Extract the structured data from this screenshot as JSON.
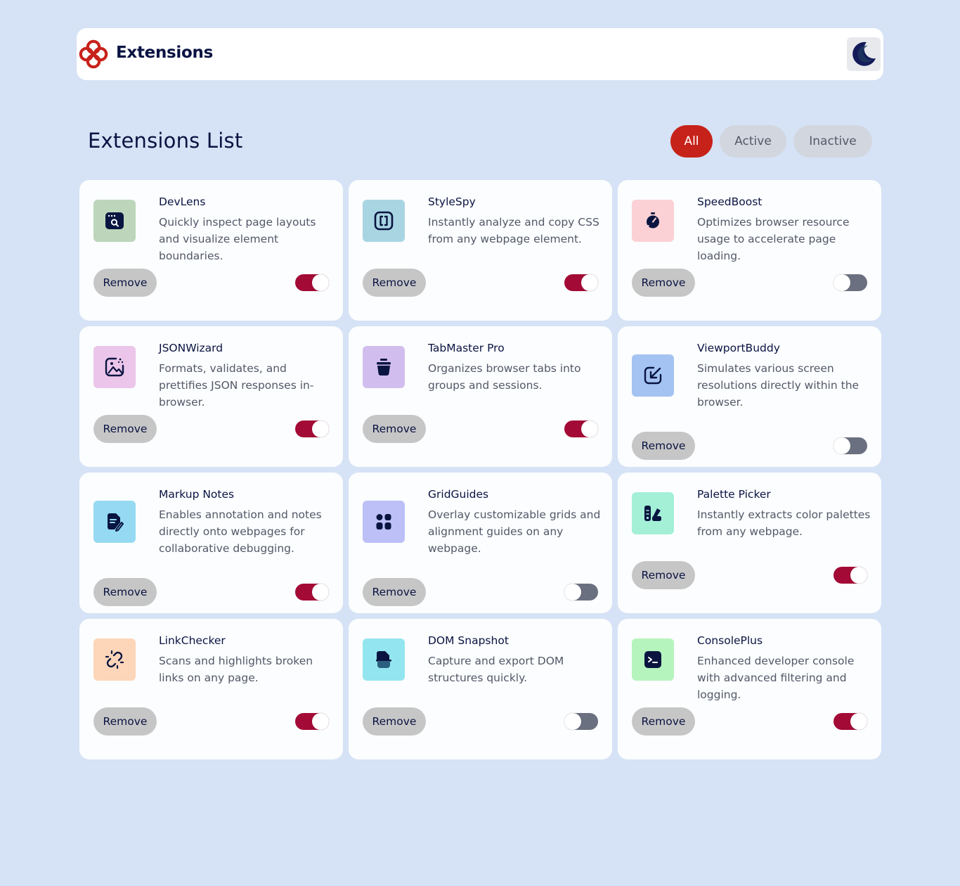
{
  "app": {
    "brand": "Extensions",
    "logo_icon": "logo-icon",
    "theme_icon": "moon-icon"
  },
  "main": {
    "title": "Extensions List",
    "filters": [
      "All",
      "Active",
      "Inactive"
    ],
    "selected_filter": "All"
  },
  "colors": {
    "accent": "#c7221a",
    "toggle_on": "#a30a35",
    "toggle_off": "#6b7080",
    "background": "#d6e2f5"
  },
  "extensions": [
    {
      "name": "DevLens",
      "description": "Quickly inspect page layouts and visualize element boundaries.",
      "active": true,
      "icon": "browser-search-icon",
      "icon_bg": "#bdd6bb",
      "remove_label": "Remove"
    },
    {
      "name": "StyleSpy",
      "description": "Instantly analyze and copy CSS from any webpage element.",
      "active": true,
      "icon": "bracket-box-icon",
      "icon_bg": "#a9d5e3",
      "remove_label": "Remove"
    },
    {
      "name": "SpeedBoost",
      "description": "Optimizes browser resource usage to accelerate page loading.",
      "active": false,
      "icon": "stopwatch-icon",
      "icon_bg": "#fbd1d5",
      "remove_label": "Remove"
    },
    {
      "name": "JSONWizard",
      "description": "Formats, validates, and prettifies JSON responses in-browser.",
      "active": true,
      "icon": "image-sparkle-icon",
      "icon_bg": "#ecc5ea",
      "remove_label": "Remove"
    },
    {
      "name": "TabMaster Pro",
      "description": "Organizes browser tabs into groups and sessions.",
      "active": true,
      "icon": "basket-icon",
      "icon_bg": "#d2bdef",
      "remove_label": "Remove"
    },
    {
      "name": "ViewportBuddy",
      "description": "Simulates various screen resolutions directly within the browser.",
      "active": false,
      "icon": "resize-arrow-icon",
      "icon_bg": "#a4c3f3",
      "remove_label": "Remove"
    },
    {
      "name": "Markup Notes",
      "description": "Enables annotation and notes directly onto webpages for collaborative debugging.",
      "active": true,
      "icon": "note-pen-icon",
      "icon_bg": "#95daf2",
      "remove_label": "Remove"
    },
    {
      "name": "GridGuides",
      "description": "Overlay customizable grids and alignment guides on any webpage.",
      "active": false,
      "icon": "grid-dots-icon",
      "icon_bg": "#bcc0f7",
      "remove_label": "Remove"
    },
    {
      "name": "Palette Picker",
      "description": "Instantly extracts color palettes from any webpage.",
      "active": true,
      "icon": "palette-icon",
      "icon_bg": "#a3f0d6",
      "remove_label": "Remove"
    },
    {
      "name": "LinkChecker",
      "description": "Scans and highlights broken links on any page.",
      "active": true,
      "icon": "broken-link-icon",
      "icon_bg": "#fdd5b9",
      "remove_label": "Remove"
    },
    {
      "name": "DOM Snapshot",
      "description": "Capture and export DOM structures quickly.",
      "active": false,
      "icon": "document-snapshot-icon",
      "icon_bg": "#93e6ef",
      "remove_label": "Remove"
    },
    {
      "name": "ConsolePlus",
      "description": "Enhanced developer console with advanced filtering and logging.",
      "active": true,
      "icon": "terminal-icon",
      "icon_bg": "#b6f4bd",
      "remove_label": "Remove"
    }
  ]
}
